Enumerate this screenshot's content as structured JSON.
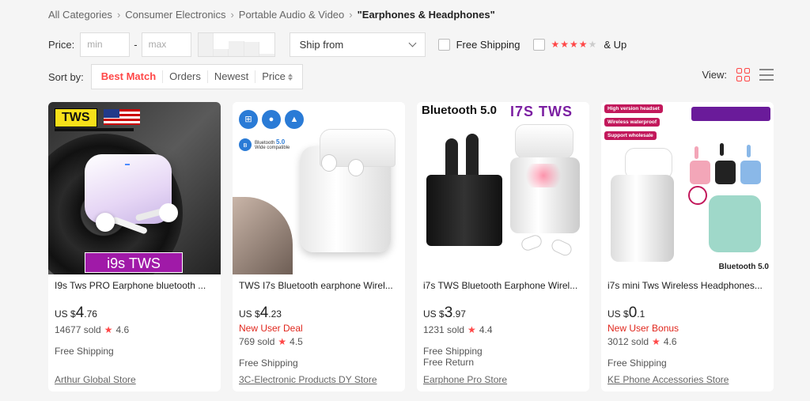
{
  "breadcrumb": {
    "items": [
      "All Categories",
      "Consumer Electronics",
      "Portable Audio & Video"
    ],
    "current": "\"Earphones & Headphones\""
  },
  "filters": {
    "price_label": "Price:",
    "min_placeholder": "min",
    "max_placeholder": "max",
    "dash": "-",
    "ship_from": "Ship from",
    "free_shipping": "Free Shipping",
    "rating_stars": 4,
    "rating_suffix": "& Up"
  },
  "sort": {
    "label": "Sort by:",
    "options": [
      "Best Match",
      "Orders",
      "Newest",
      "Price"
    ],
    "active": "Best Match"
  },
  "view": {
    "label": "View:"
  },
  "colors": {
    "accent": "#ff4747",
    "promo": "#e0261c"
  },
  "products": [
    {
      "title": "I9s Tws PRO Earphone bluetooth ...",
      "currency": "US $",
      "price_int": "4",
      "price_dec": ".76",
      "promo": "",
      "sold": "14677 sold",
      "rating": "4.6",
      "shipping": [
        "Free Shipping"
      ],
      "store": "Arthur Global Store",
      "image_text": {
        "badge": "TWS",
        "name": "i9s TWS"
      }
    },
    {
      "title": "TWS I7s Bluetooth earphone Wirel...",
      "currency": "US $",
      "price_int": "4",
      "price_dec": ".23",
      "promo": "New User Deal",
      "sold": "769 sold",
      "rating": "4.5",
      "shipping": [
        "Free Shipping"
      ],
      "store": "3C-Electronic Products DY Store",
      "image_text": {
        "bt": "Bluetooth",
        "ver": "5.0",
        "wide": "Wide compatible"
      }
    },
    {
      "title": "i7s TWS Bluetooth Earphone Wirel...",
      "currency": "US $",
      "price_int": "3",
      "price_dec": ".97",
      "promo": "",
      "sold": "1231 sold",
      "rating": "4.4",
      "shipping": [
        "Free Shipping",
        "Free Return"
      ],
      "store": "Earphone Pro Store",
      "image_text": {
        "bt": "Bluetooth 5.0",
        "name": "I7S TWS"
      }
    },
    {
      "title": "i7s mini Tws Wireless Headphones...",
      "currency": "US $",
      "price_int": "0",
      "price_dec": ".1",
      "promo": "New User Bonus",
      "sold": "3012 sold",
      "rating": "4.6",
      "shipping": [
        "Free Shipping"
      ],
      "store": "KE Phone Accessories Store",
      "image_text": {
        "tag1": "High version headset",
        "tag2": "Wireless waterproof",
        "tag3": "Support wholesale",
        "bt": "Bluetooth 5.0"
      }
    }
  ]
}
